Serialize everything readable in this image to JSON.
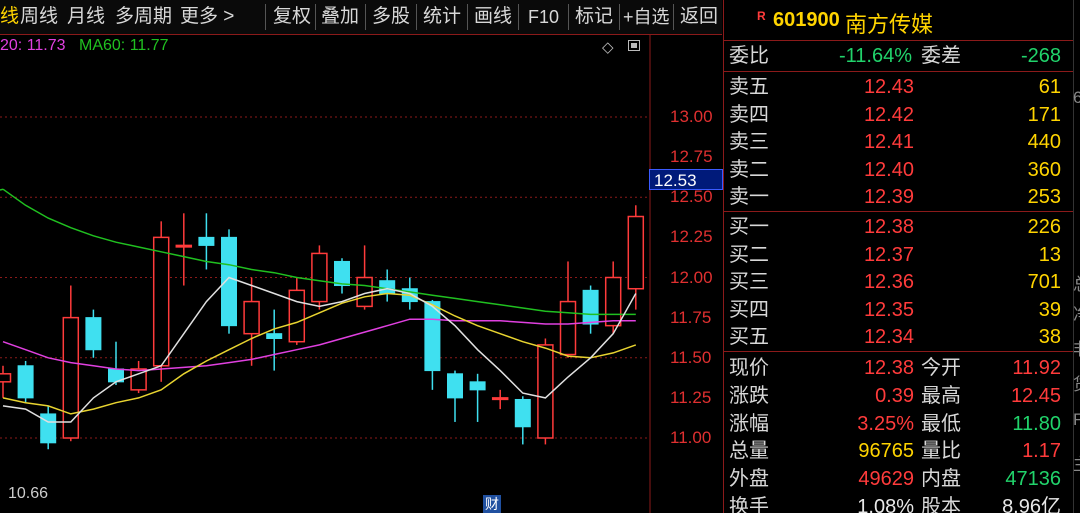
{
  "toolbar": {
    "items": [
      "周线",
      "月线",
      "多周期",
      "更多 >",
      "复权",
      "叠加",
      "多股",
      "统计",
      "画线",
      "F10",
      "标记",
      "+自选",
      "返回"
    ]
  },
  "chart": {
    "legend_ma20": "20: 11.73",
    "legend_ma60": "MA60: 11.77",
    "price_ticks": [
      "13.00",
      "12.75",
      "12.50",
      "12.25",
      "12.00",
      "11.75",
      "11.50",
      "11.25",
      "11.00"
    ],
    "current_price": "12.53",
    "low_label": "10.66",
    "marker_label": "财",
    "colors": {
      "ma5": "#e0e0e0",
      "ma10": "#e8d430",
      "ma20": "#e040e0",
      "ma60": "#20c020",
      "up": "#ff3b3b",
      "down": "#3fe0f0"
    }
  },
  "chart_data": {
    "type": "candlestick",
    "yaxis_ticks": [
      13.0,
      12.75,
      12.5,
      12.25,
      12.0,
      11.75,
      11.5,
      11.25,
      11.0
    ],
    "candles": [
      {
        "o": 11.35,
        "c": 11.4,
        "h": 11.45,
        "l": 11.25
      },
      {
        "o": 11.45,
        "c": 11.25,
        "h": 11.48,
        "l": 11.22
      },
      {
        "o": 11.15,
        "c": 10.97,
        "h": 11.2,
        "l": 10.93
      },
      {
        "o": 11.0,
        "c": 11.75,
        "h": 11.95,
        "l": 10.98
      },
      {
        "o": 11.75,
        "c": 11.55,
        "h": 11.8,
        "l": 11.5
      },
      {
        "o": 11.43,
        "c": 11.35,
        "h": 11.6,
        "l": 11.33
      },
      {
        "o": 11.3,
        "c": 11.43,
        "h": 11.48,
        "l": 11.28
      },
      {
        "o": 11.45,
        "c": 12.25,
        "h": 12.35,
        "l": 11.35
      },
      {
        "o": 12.2,
        "c": 12.2,
        "h": 12.4,
        "l": 11.95
      },
      {
        "o": 12.25,
        "c": 12.2,
        "h": 12.4,
        "l": 12.05
      },
      {
        "o": 12.25,
        "c": 11.7,
        "h": 12.3,
        "l": 11.65
      },
      {
        "o": 11.65,
        "c": 11.85,
        "h": 12.0,
        "l": 11.45
      },
      {
        "o": 11.65,
        "c": 11.62,
        "h": 11.8,
        "l": 11.42
      },
      {
        "o": 11.6,
        "c": 11.92,
        "h": 12.0,
        "l": 11.58
      },
      {
        "o": 11.85,
        "c": 12.15,
        "h": 12.2,
        "l": 11.8
      },
      {
        "o": 12.1,
        "c": 11.95,
        "h": 12.12,
        "l": 11.9
      },
      {
        "o": 11.82,
        "c": 12.0,
        "h": 12.2,
        "l": 11.8
      },
      {
        "o": 11.98,
        "c": 11.9,
        "h": 12.05,
        "l": 11.85
      },
      {
        "o": 11.93,
        "c": 11.85,
        "h": 12.0,
        "l": 11.8
      },
      {
        "o": 11.85,
        "c": 11.42,
        "h": 11.86,
        "l": 11.3
      },
      {
        "o": 11.4,
        "c": 11.25,
        "h": 11.42,
        "l": 11.1
      },
      {
        "o": 11.35,
        "c": 11.3,
        "h": 11.4,
        "l": 11.1
      },
      {
        "o": 11.25,
        "c": 11.25,
        "h": 11.3,
        "l": 11.18
      },
      {
        "o": 11.24,
        "c": 11.07,
        "h": 11.26,
        "l": 10.96
      },
      {
        "o": 11.0,
        "c": 11.58,
        "h": 11.62,
        "l": 10.96
      },
      {
        "o": 11.52,
        "c": 11.85,
        "h": 12.1,
        "l": 11.5
      },
      {
        "o": 11.92,
        "c": 11.71,
        "h": 11.95,
        "l": 11.65
      },
      {
        "o": 11.7,
        "c": 12.0,
        "h": 12.1,
        "l": 11.65
      },
      {
        "o": 11.93,
        "c": 12.38,
        "h": 12.45,
        "l": 11.8
      }
    ],
    "ma5": [
      11.2,
      11.18,
      11.1,
      11.1,
      11.25,
      11.35,
      11.4,
      11.45,
      11.65,
      11.85,
      12.0,
      11.95,
      11.9,
      11.85,
      11.82,
      11.85,
      11.9,
      11.93,
      11.9,
      11.82,
      11.7,
      11.55,
      11.42,
      11.28,
      11.25,
      11.38,
      11.5,
      11.65,
      11.9
    ],
    "ma10": [
      11.25,
      11.22,
      11.2,
      11.15,
      11.18,
      11.22,
      11.25,
      11.3,
      11.4,
      11.48,
      11.55,
      11.62,
      11.68,
      11.72,
      11.78,
      11.84,
      11.88,
      11.9,
      11.89,
      11.83,
      11.76,
      11.7,
      11.65,
      11.6,
      11.56,
      11.51,
      11.5,
      11.53,
      11.58
    ],
    "ma20": [
      11.6,
      11.55,
      11.5,
      11.47,
      11.45,
      11.43,
      11.42,
      11.43,
      11.44,
      11.45,
      11.47,
      11.49,
      11.52,
      11.55,
      11.58,
      11.62,
      11.66,
      11.7,
      11.74,
      11.74,
      11.73,
      11.73,
      11.73,
      11.72,
      11.71,
      11.71,
      11.72,
      11.73,
      11.73
    ],
    "ma60": [
      12.55,
      12.45,
      12.37,
      12.31,
      12.26,
      12.22,
      12.19,
      12.16,
      12.13,
      12.1,
      12.08,
      12.05,
      12.03,
      12.0,
      11.98,
      11.96,
      11.95,
      11.93,
      11.91,
      11.89,
      11.87,
      11.85,
      11.83,
      11.81,
      11.79,
      11.78,
      11.77,
      11.77,
      11.77
    ]
  },
  "panel": {
    "badge": "R",
    "code": "601900",
    "name": "南方传媒",
    "weibi_label": "委比",
    "weibi_value": "-11.64%",
    "weicha_label": "委差",
    "weicha_value": "-268",
    "asks": [
      {
        "label": "卖五",
        "price": "12.43",
        "vol": "61"
      },
      {
        "label": "卖四",
        "price": "12.42",
        "vol": "171"
      },
      {
        "label": "卖三",
        "price": "12.41",
        "vol": "440"
      },
      {
        "label": "卖二",
        "price": "12.40",
        "vol": "360"
      },
      {
        "label": "卖一",
        "price": "12.39",
        "vol": "253"
      }
    ],
    "bids": [
      {
        "label": "买一",
        "price": "12.38",
        "vol": "226"
      },
      {
        "label": "买二",
        "price": "12.37",
        "vol": "13"
      },
      {
        "label": "买三",
        "price": "12.36",
        "vol": "701"
      },
      {
        "label": "买四",
        "price": "12.35",
        "vol": "39"
      },
      {
        "label": "买五",
        "price": "12.34",
        "vol": "38"
      }
    ],
    "quotes": [
      {
        "l1": "现价",
        "v1": "12.38",
        "c1": "red",
        "l2": "今开",
        "v2": "11.92",
        "c2": "red"
      },
      {
        "l1": "涨跌",
        "v1": "0.39",
        "c1": "red",
        "l2": "最高",
        "v2": "12.45",
        "c2": "red"
      },
      {
        "l1": "涨幅",
        "v1": "3.25%",
        "c1": "red",
        "l2": "最低",
        "v2": "11.80",
        "c2": "green"
      },
      {
        "l1": "总量",
        "v1": "96765",
        "c1": "yellow",
        "l2": "量比",
        "v2": "1.17",
        "c2": "red"
      },
      {
        "l1": "外盘",
        "v1": "49629",
        "c1": "red",
        "l2": "内盘",
        "v2": "47136",
        "c2": "green"
      },
      {
        "l1": "换手",
        "v1": "1.08%",
        "c1": "white",
        "l2": "股本",
        "v2": "8.96亿",
        "c2": "white"
      }
    ]
  },
  "edge_chars": [
    "6",
    "总",
    "净",
    "非",
    "货",
    "F",
    "主"
  ]
}
